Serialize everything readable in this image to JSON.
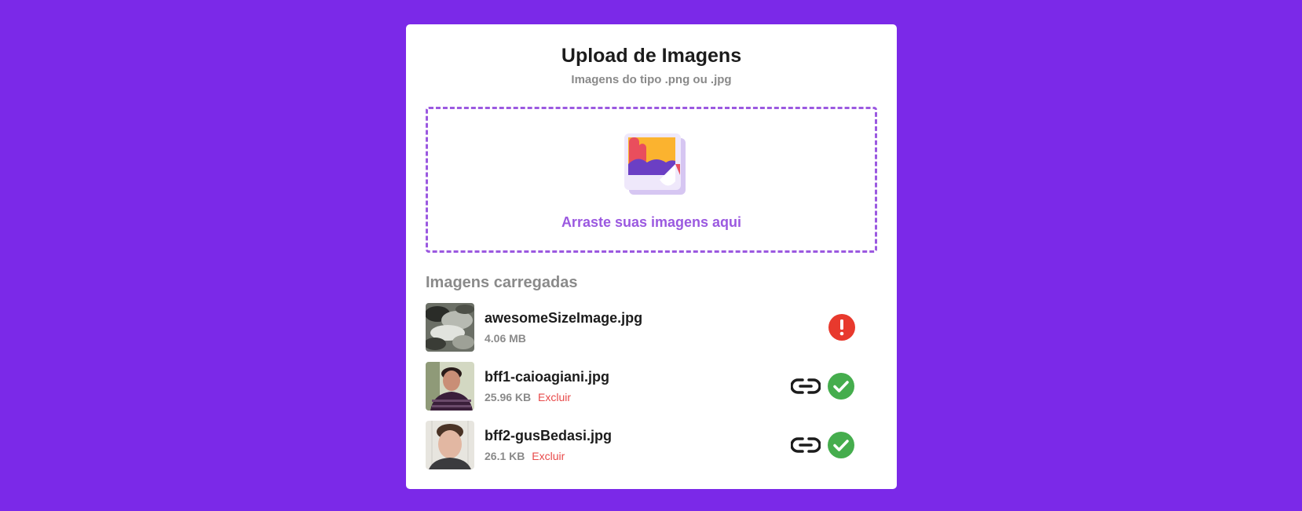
{
  "header": {
    "title": "Upload de Imagens",
    "subtitle": "Imagens do tipo .png ou .jpg"
  },
  "dropzone": {
    "label": "Arraste suas imagens aqui",
    "icon": "image-upload-icon"
  },
  "files": {
    "heading": "Imagens carregadas",
    "items": [
      {
        "name": "awesomeSizeImage.jpg",
        "size": "4.06 MB",
        "delete_label": "",
        "status": "error",
        "status_icon": "error-icon"
      },
      {
        "name": "bff1-caioagiani.jpg",
        "size": "25.96 KB",
        "delete_label": "Excluir",
        "status": "success",
        "status_icon": "check-icon",
        "link_icon": "link-icon"
      },
      {
        "name": "bff2-gusBedasi.jpg",
        "size": "26.1 KB",
        "delete_label": "Excluir",
        "status": "success",
        "status_icon": "check-icon",
        "link_icon": "link-icon"
      }
    ]
  },
  "colors": {
    "background": "#7b29e8",
    "accent": "#9b59e0",
    "error": "#e8392d",
    "success": "#45ad4d",
    "delete": "#e84a4a"
  }
}
